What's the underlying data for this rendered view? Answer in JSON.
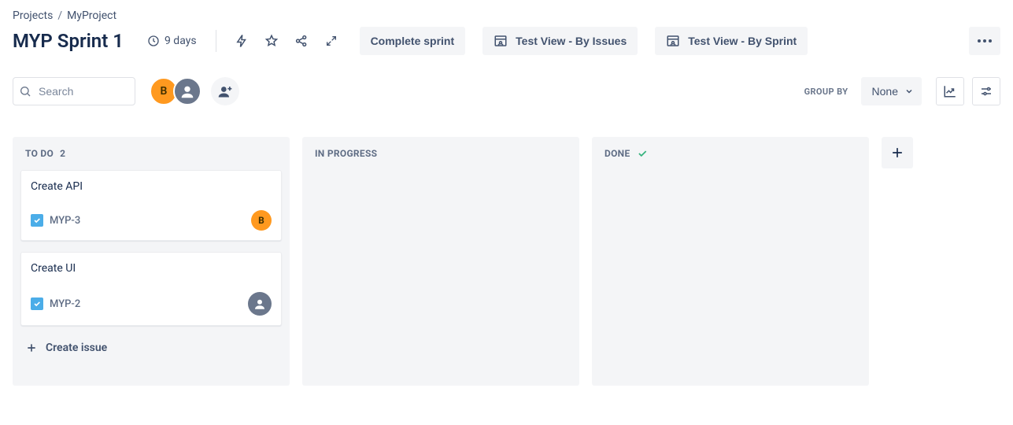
{
  "breadcrumb": {
    "root": "Projects",
    "project": "MyProject"
  },
  "header": {
    "title": "MYP Sprint 1",
    "days_remaining": "9 days",
    "complete_sprint_label": "Complete sprint",
    "views": [
      {
        "label": "Test View - By Issues"
      },
      {
        "label": "Test View - By Sprint"
      }
    ]
  },
  "toolbar": {
    "search_placeholder": "Search",
    "avatars": [
      {
        "initial": "B",
        "kind": "orange"
      },
      {
        "initial": "",
        "kind": "grey"
      }
    ],
    "groupby_label": "GROUP BY",
    "groupby_value": "None"
  },
  "board": {
    "columns": [
      {
        "id": "todo",
        "title": "TO DO",
        "count": "2",
        "show_check": false,
        "cards": [
          {
            "title": "Create API",
            "key": "MYP-3",
            "assignee": {
              "kind": "orange",
              "initial": "B"
            }
          },
          {
            "title": "Create UI",
            "key": "MYP-2",
            "assignee": {
              "kind": "grey",
              "initial": ""
            }
          }
        ],
        "create_issue_label": "Create issue"
      },
      {
        "id": "inprogress",
        "title": "IN PROGRESS",
        "count": "",
        "show_check": false,
        "cards": []
      },
      {
        "id": "done",
        "title": "DONE",
        "count": "",
        "show_check": true,
        "cards": []
      }
    ]
  }
}
